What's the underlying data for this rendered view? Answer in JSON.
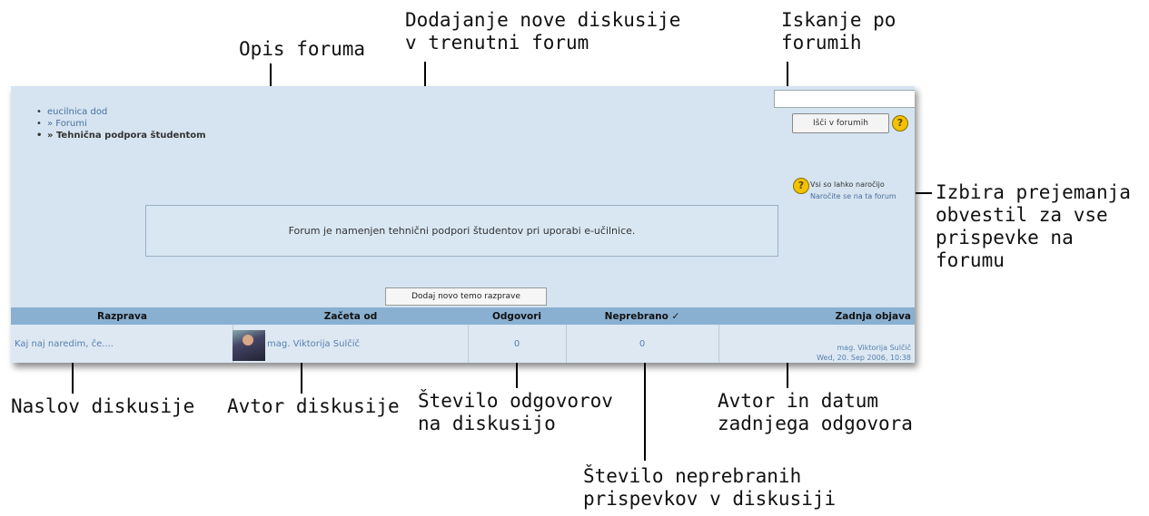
{
  "annotations": {
    "opis_foruma": "Opis foruma",
    "dodajanje": [
      "Dodajanje nove diskusije",
      "v trenutni forum"
    ],
    "iskanje": [
      "Iskanje po",
      "forumih"
    ],
    "izbira": [
      "Izbira prejemanja",
      "obvestil za vse",
      "prispevke na",
      "forumu"
    ],
    "naslov": "Naslov diskusije",
    "avtor": "Avtor diskusije",
    "stevilo_odgovorov": [
      "Število odgovorov",
      "na diskusijo"
    ],
    "avtor_datum": [
      "Avtor in datum",
      "zadnjega odgovora"
    ],
    "neprebrani": [
      "Število neprebranih",
      "prispevkov v diskusiji"
    ]
  },
  "breadcrumb": [
    "eucilnica dod",
    "» Forumi",
    "» Tehnična podpora študentom"
  ],
  "search": {
    "button_label": "Išči v forumih"
  },
  "help_icon": "?",
  "subscription": {
    "line1": "Vsi so lahko naročijo",
    "line2": "Naročite se na ta forum"
  },
  "forum_description": "Forum je namenjen tehnični podpori študentov pri uporabi e-učilnice.",
  "add_button": "Dodaj novo temo razprave",
  "table": {
    "headers": [
      "Razprava",
      "Začeta od",
      "Odgovori",
      "Neprebrano ✓",
      "Zadnja objava"
    ],
    "rows": [
      {
        "title": "Kaj naj naredim, če....",
        "author": "mag. Viktorija Sulčič",
        "replies": "0",
        "unread": "0",
        "last_author": "mag. Viktorija Sulčič",
        "last_date": "Wed, 20. Sep 2006, 10:38"
      }
    ]
  },
  "colors": {
    "panel_bg": "#d5e4f0",
    "header_bg": "#8ab0d1",
    "link": "#4a6fa0"
  }
}
